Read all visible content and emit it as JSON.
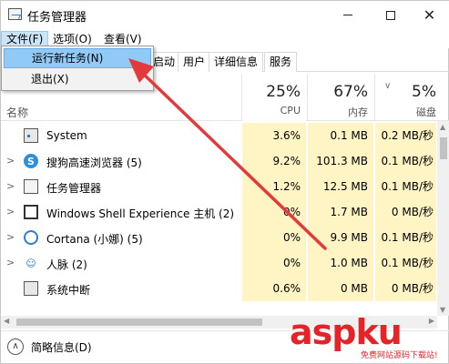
{
  "window": {
    "title": "任务管理器",
    "close_glyph": "✕"
  },
  "menubar": {
    "file": "文件(F)",
    "options": "选项(O)",
    "view": "查看(V)"
  },
  "file_menu": {
    "run_new_task": "运行新任务(N)",
    "exit": "退出(X)"
  },
  "tabs": {
    "startup": "启动",
    "users": "用户",
    "details": "详细信息",
    "services": "服务"
  },
  "columns": {
    "name": "名称",
    "cpu_pct": "25%",
    "cpu_label": "CPU",
    "mem_pct": "67%",
    "mem_label": "内存",
    "disk_pct": "5%",
    "disk_label": "磁盘"
  },
  "rows": [
    {
      "name": "System",
      "expandable": false,
      "icon": "system-icon",
      "cpu": "3.6%",
      "mem": "0.1 MB",
      "disk": "0.2 MB/秒"
    },
    {
      "name": "搜狗高速浏览器 (5)",
      "expandable": true,
      "icon": "sogou-browser-icon",
      "cpu": "9.2%",
      "mem": "101.3 MB",
      "disk": "0.1 MB/秒"
    },
    {
      "name": "任务管理器",
      "expandable": true,
      "icon": "task-manager-icon",
      "cpu": "1.2%",
      "mem": "12.5 MB",
      "disk": "0.1 MB/秒"
    },
    {
      "name": "Windows Shell Experience 主机 (2)",
      "expandable": true,
      "icon": "shell-experience-icon",
      "cpu": "0%",
      "mem": "1.7 MB",
      "disk": "0 MB/秒"
    },
    {
      "name": "Cortana (小娜) (5)",
      "expandable": true,
      "icon": "cortana-icon",
      "cpu": "0%",
      "mem": "9.9 MB",
      "disk": "0.1 MB/秒"
    },
    {
      "name": "人脉 (2)",
      "expandable": true,
      "icon": "people-icon",
      "cpu": "0%",
      "mem": "1.0 MB",
      "disk": "0.1 MB/秒"
    },
    {
      "name": "系统中断",
      "expandable": false,
      "icon": "interrupt-icon",
      "cpu": "0.6%",
      "mem": "0 MB",
      "disk": "0 MB/秒"
    }
  ],
  "footer": {
    "fewer_details": "简略信息(D)"
  },
  "watermark": {
    "main_a": "asp",
    "main_b": "ku",
    "sub": "免费网站源码下载站!"
  },
  "colors": {
    "accent": "#2a7fd0",
    "cpu_heat": "#fff4c4",
    "menu_highlight": "#91c9f7",
    "arrow": "#e23a3a",
    "watermark": "#e5242a"
  }
}
